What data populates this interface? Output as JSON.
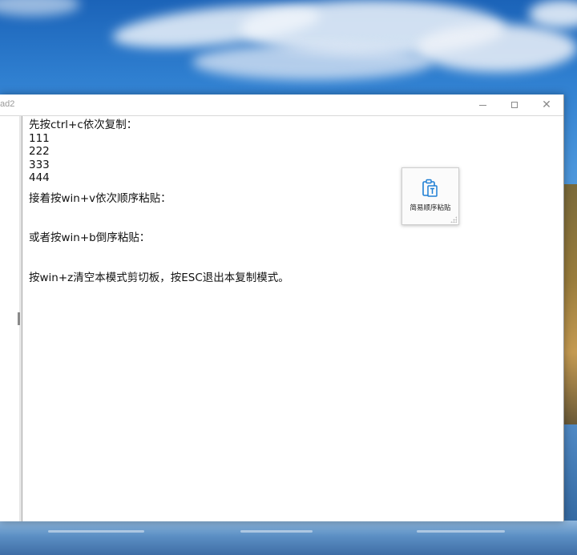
{
  "window": {
    "title": "ad2"
  },
  "editor": {
    "lines": {
      "l1": "先按ctrl+c依次复制：",
      "l2": "111",
      "l3": "222",
      "l4": "333",
      "l5": "444",
      "l6": "接着按win+v依次顺序粘贴：",
      "l7": "或者按win+b倒序粘贴：",
      "l8": "按win+z清空本模式剪切板，按ESC退出本复制模式。"
    }
  },
  "popup": {
    "label": "简易顺序粘贴",
    "icon": "clipboard-paste-icon",
    "accent": "#1f7fd4"
  },
  "icons": {
    "minimize": "minimize-icon",
    "maximize": "maximize-icon",
    "close": "close-icon"
  }
}
